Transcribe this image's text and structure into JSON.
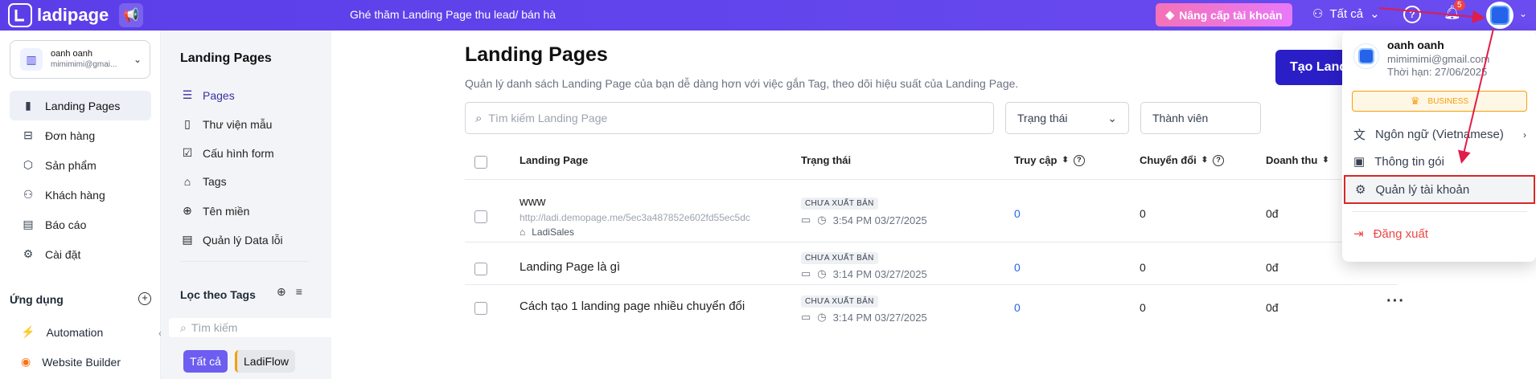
{
  "topbar": {
    "brand": "ladipage",
    "announcement": "Ghé thăm Landing Page thu lead/ bán hà",
    "upgrade_label": "Nâng cấp tài khoản",
    "filter_label": "Tất cả",
    "notification_count": "5",
    "brand_color": "#5b3ee8"
  },
  "sidebar": {
    "account": {
      "name": "oanh oanh",
      "email": "mimimimi@gmai..."
    },
    "items": [
      {
        "label": "Landing Pages",
        "icon": "landing-pages-icon"
      },
      {
        "label": "Đơn hàng",
        "icon": "orders-icon"
      },
      {
        "label": "Sản phẩm",
        "icon": "products-icon"
      },
      {
        "label": "Khách hàng",
        "icon": "customers-icon"
      },
      {
        "label": "Báo cáo",
        "icon": "report-icon"
      },
      {
        "label": "Cài đặt",
        "icon": "settings-icon"
      }
    ],
    "apps_title": "Ứng dụng",
    "apps": [
      {
        "label": "Automation",
        "icon": "automation-icon"
      },
      {
        "label": "Website Builder",
        "icon": "website-builder-icon"
      }
    ]
  },
  "subnav": {
    "title": "Landing Pages",
    "items": [
      {
        "label": "Pages"
      },
      {
        "label": "Thư viện mẫu"
      },
      {
        "label": "Cấu hình form"
      },
      {
        "label": "Tags"
      },
      {
        "label": "Tên miền"
      },
      {
        "label": "Quản lý Data lỗi"
      }
    ],
    "tags_title": "Lọc theo Tags",
    "tag_search_placeholder": "Tìm kiếm",
    "chips": [
      "Tất cả",
      "LadiFlow"
    ]
  },
  "main": {
    "title": "Landing Pages",
    "subtitle": "Quản lý danh sách Landing Page của bạn dễ dàng hơn với việc gắn Tag, theo dõi hiệu suất của Landing Page.",
    "create_label": "Tạo Land",
    "search_placeholder": "Tìm kiếm Landing Page",
    "status_filter": "Trạng thái",
    "member_filter": "Thành viên",
    "columns": [
      "Landing Page",
      "Trạng thái",
      "Truy cập",
      "Chuyển đổi",
      "Doanh thu"
    ],
    "rows": [
      {
        "title": "www",
        "url": "http://ladi.demopage.me/5ec3a487852e602fd55ec5dc",
        "tag": "LadiSales",
        "status": "CHƯA XUẤT BẢN",
        "time": "3:54 PM 03/27/2025",
        "visits": "0",
        "conversions": "0",
        "revenue": "0đ"
      },
      {
        "title": "Landing Page là gì",
        "url": "",
        "tag": "",
        "status": "CHƯA XUẤT BẢN",
        "time": "3:14 PM 03/27/2025",
        "visits": "0",
        "conversions": "0",
        "revenue": "0đ"
      },
      {
        "title": "Cách tạo 1 landing page nhiều chuyển đổi",
        "url": "",
        "tag": "",
        "status": "CHƯA XUẤT BẢN",
        "time": "3:14 PM 03/27/2025",
        "visits": "0",
        "conversions": "0",
        "revenue": "0đ"
      }
    ]
  },
  "dropdown": {
    "name": "oanh oanh",
    "email": "mimimimi@gmail.com",
    "expiry": "Thời hạn: 27/06/2025",
    "plan": "BUSINESS",
    "language": "Ngôn ngữ (Vietnamese)",
    "package_info": "Thông tin gói",
    "account_manage": "Quản lý tài khoản",
    "logout": "Đăng xuất"
  }
}
